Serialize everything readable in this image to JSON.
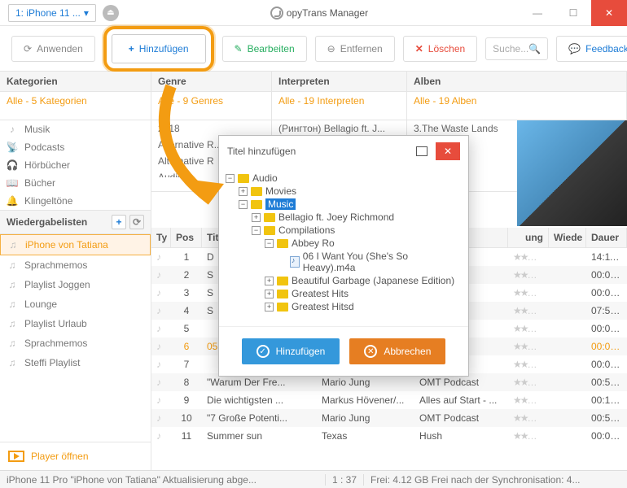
{
  "device": "1: iPhone 11 ...",
  "brand": "opyTrans Manager",
  "toolbar": {
    "apply": "Anwenden",
    "add": "Hinzufügen",
    "edit": "Bearbeiten",
    "remove": "Entfernen",
    "delete": "Löschen",
    "search": "Suche...",
    "feedback": "Feedback"
  },
  "cats_h": "Kategorien",
  "cats_all": "Alle - 5 Kategorien",
  "cats": [
    "Musik",
    "Podcasts",
    "Hörbücher",
    "Bücher",
    "Klingeltöne"
  ],
  "pl_h": "Wiedergabelisten",
  "playlists": [
    {
      "n": "iPhone von Tatiana",
      "active": true
    },
    {
      "n": "Sprachmemos"
    },
    {
      "n": "Playlist Joggen"
    },
    {
      "n": "Lounge"
    },
    {
      "n": "Playlist Urlaub"
    },
    {
      "n": "Sprachmemos"
    },
    {
      "n": "Steffi Playlist"
    }
  ],
  "player_open": "Player öffnen",
  "genre_h": "Genre",
  "genre_all": "Alle - 9 Genres",
  "genres": [
    "2018",
    "Alternative R...",
    "Alternative R",
    "Audio",
    "Audio"
  ],
  "artist_h": "Interpreten",
  "artist_all": "Alle - 19 Interpreten",
  "artists": [
    "(Рингтон) Bellagio ft. J..."
  ],
  "album_h": "Alben",
  "album_all": "Alle - 19 Alben",
  "albums": [
    "3.The Waste Lands"
  ],
  "cols": {
    "type": "Ty",
    "pos": "Pos",
    "title": "Tit",
    "rating": "ung",
    "plays": "Wiede",
    "dur": "Dauer"
  },
  "rows": [
    {
      "p": "1",
      "t": "D",
      "a": "",
      "al": "",
      "d": "14:11:..."
    },
    {
      "p": "2",
      "t": "S",
      "a": "",
      "al": "",
      "d": "00:00:..."
    },
    {
      "p": "3",
      "t": "S",
      "a": "",
      "al": "",
      "d": "00:00:..."
    },
    {
      "p": "4",
      "t": "S",
      "a": "",
      "al": "",
      "d": "07:54:..."
    },
    {
      "p": "5",
      "t": "",
      "a": "",
      "al": "",
      "d": "00:00:..."
    },
    {
      "p": "6",
      "t": "05",
      "a": "",
      "al": "",
      "d": "00:02:...",
      "active": true
    },
    {
      "p": "7",
      "t": "",
      "a": "",
      "al": "",
      "d": "00:00:..."
    },
    {
      "p": "8",
      "t": "\"Warum Der Fre...",
      "a": "Mario Jung",
      "al": "OMT Podcast",
      "d": "00:53:..."
    },
    {
      "p": "9",
      "t": "Die wichtigsten ...",
      "a": "Markus Hövener/...",
      "al": "Alles auf Start - ...",
      "d": "00:15:..."
    },
    {
      "p": "10",
      "t": "\"7 Große Potenti...",
      "a": "Mario Jung",
      "al": "OMT Podcast",
      "d": "00:57:..."
    },
    {
      "p": "11",
      "t": "Summer sun",
      "a": "Texas",
      "al": "Hush",
      "d": "00:04:..."
    }
  ],
  "status": {
    "s1": "iPhone 11 Pro \"iPhone von Tatiana\" Aktualisierung abge...",
    "s2": "1 : 37",
    "s3": "Frei: 4.12 GB Frei nach der Synchronisation: 4..."
  },
  "dialog": {
    "title": "Titel hinzufügen",
    "tree": [
      {
        "l": 0,
        "e": "-",
        "n": "Audio"
      },
      {
        "l": 1,
        "e": "+",
        "n": "Movies"
      },
      {
        "l": 1,
        "e": "-",
        "n": "Music",
        "sel": true
      },
      {
        "l": 2,
        "e": "+",
        "n": "Bellagio ft. Joey Richmond"
      },
      {
        "l": 2,
        "e": "-",
        "n": "Compilations"
      },
      {
        "l": 3,
        "e": "-",
        "n": "Abbey Ro"
      },
      {
        "l": 4,
        "e": "",
        "n": "06 I Want You (She's So Heavy).m4a",
        "file": true
      },
      {
        "l": 3,
        "e": "+",
        "n": "Beautiful Garbage (Japanese Edition)"
      },
      {
        "l": 3,
        "e": "+",
        "n": "Greatest Hits"
      },
      {
        "l": 3,
        "e": "+",
        "n": "Greatest Hitsd"
      }
    ],
    "ok": "Hinzufügen",
    "cancel": "Abbrechen"
  }
}
